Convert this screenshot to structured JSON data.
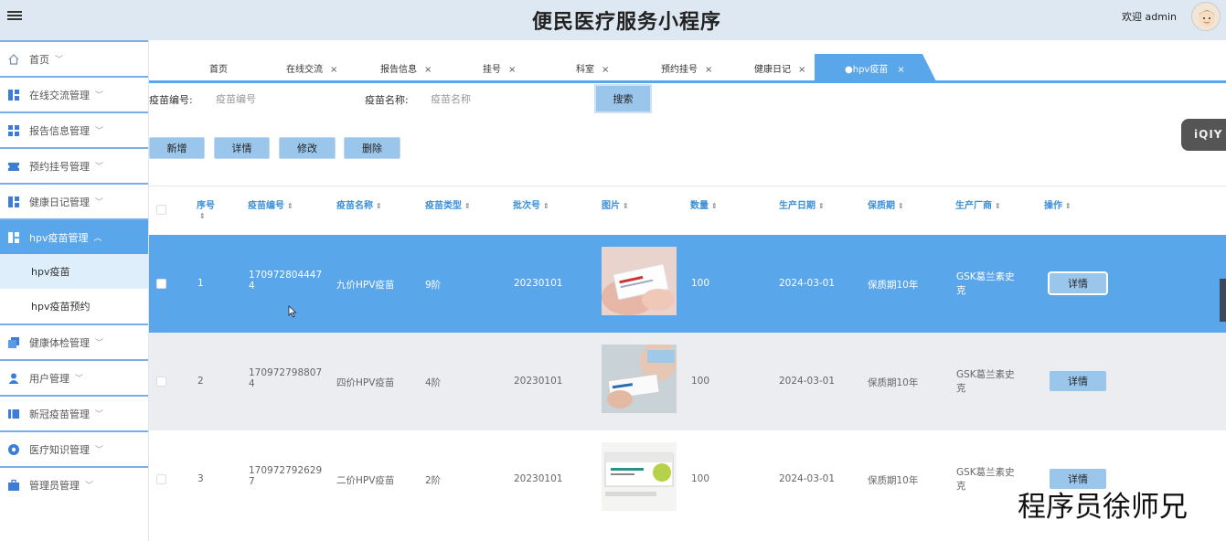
{
  "header": {
    "title": "便民医疗服务小程序",
    "welcome": "欢迎 admin"
  },
  "sidebar": {
    "items": [
      {
        "label": "首页"
      },
      {
        "label": "在线交流管理"
      },
      {
        "label": "报告信息管理"
      },
      {
        "label": "预约挂号管理"
      },
      {
        "label": "健康日记管理"
      },
      {
        "label": "hpv疫苗管理"
      },
      {
        "label": "健康体检管理"
      },
      {
        "label": "用户管理"
      },
      {
        "label": "新冠疫苗管理"
      },
      {
        "label": "医疗知识管理"
      },
      {
        "label": "管理员管理"
      }
    ],
    "subitems": [
      {
        "label": "hpv疫苗"
      },
      {
        "label": "hpv疫苗预约"
      }
    ]
  },
  "tabs": [
    {
      "label": "首页"
    },
    {
      "label": "在线交流"
    },
    {
      "label": "报告信息"
    },
    {
      "label": "挂号"
    },
    {
      "label": "科室"
    },
    {
      "label": "预约挂号"
    },
    {
      "label": "健康日记"
    },
    {
      "label": "●hpv疫苗"
    }
  ],
  "search": {
    "code_label": "疫苗编号:",
    "code_placeholder": "疫苗编号",
    "name_label": "疫苗名称:",
    "name_placeholder": "疫苗名称",
    "button": "搜索"
  },
  "actions": {
    "add": "新增",
    "detail": "详情",
    "edit": "修改",
    "delete": "删除"
  },
  "table": {
    "columns": [
      "序号",
      "疫苗编号",
      "疫苗名称",
      "疫苗类型",
      "批次号",
      "图片",
      "数量",
      "生产日期",
      "保质期",
      "生产厂商",
      "操作"
    ],
    "rows": [
      {
        "index": "1",
        "code_a": "170972804447",
        "code_b": "4",
        "name": "九价HPV疫苗",
        "type": "9阶",
        "batch": "20230101",
        "qty": "100",
        "date": "2024-03-01",
        "shelf": "保质期10年",
        "maker_a": "GSK葛兰素史",
        "maker_b": "克",
        "op": "详情"
      },
      {
        "index": "2",
        "code_a": "170972798807",
        "code_b": "4",
        "name": "四价HPV疫苗",
        "type": "4阶",
        "batch": "20230101",
        "qty": "100",
        "date": "2024-03-01",
        "shelf": "保质期10年",
        "maker_a": "GSK葛兰素史",
        "maker_b": "克",
        "op": "详情"
      },
      {
        "index": "3",
        "code_a": "170972792629",
        "code_b": "7",
        "name": "二价HPV疫苗",
        "type": "2阶",
        "batch": "20230101",
        "qty": "100",
        "date": "2024-03-01",
        "shelf": "保质期10年",
        "maker_a": "GSK葛兰素史",
        "maker_b": "克",
        "op": "详情"
      }
    ]
  },
  "overlay": {
    "logo": "iQIY",
    "watermark": "程序员徐师兄"
  },
  "colors": {
    "accent": "#5aa6ea",
    "header_bg": "#dde8f2",
    "button": "#9bc6ec"
  }
}
